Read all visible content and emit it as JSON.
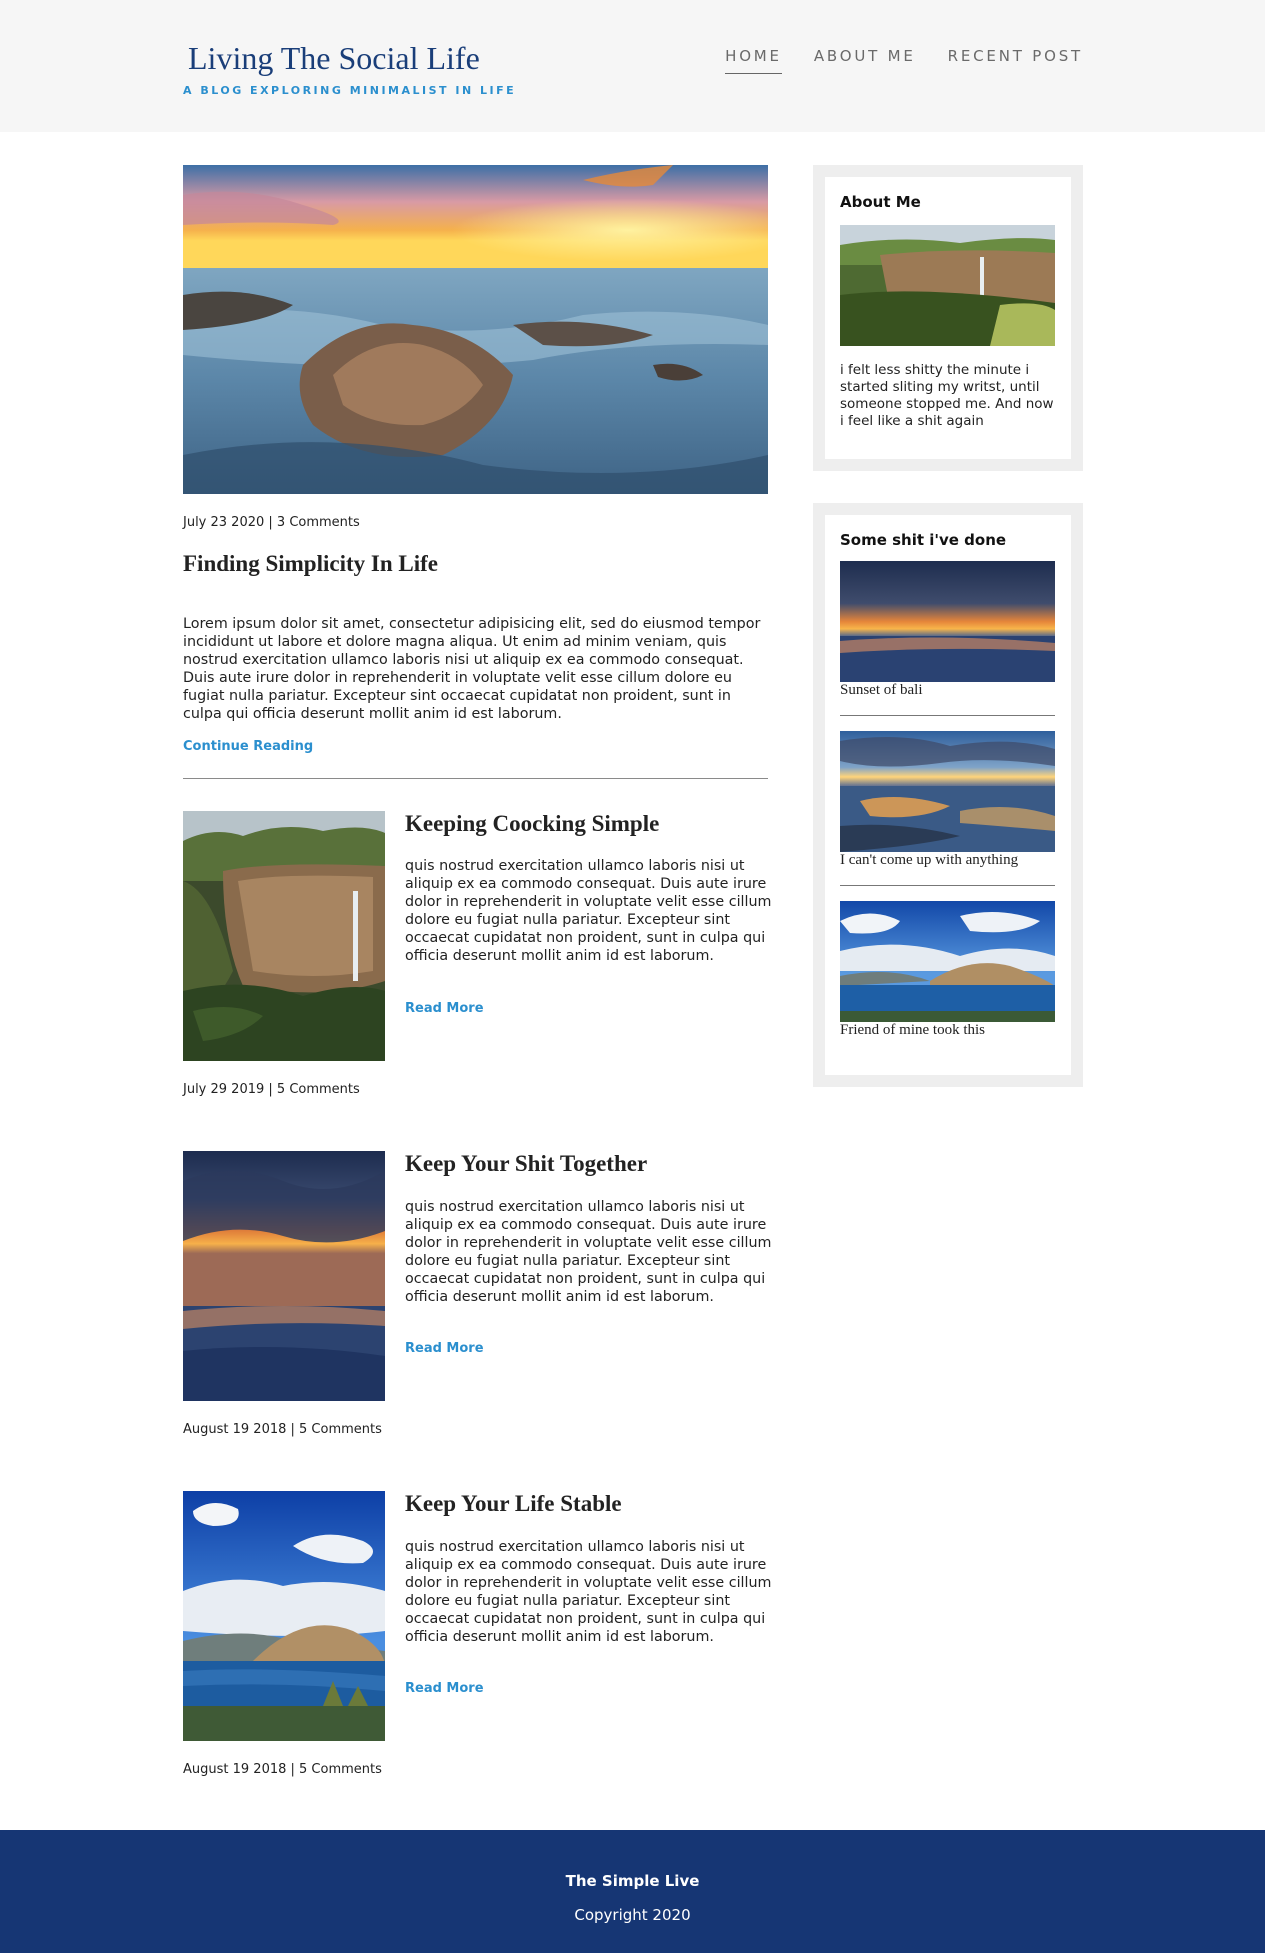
{
  "header": {
    "title": "Living The Social Life",
    "tagline": "A BLOG EXPLORING MINIMALIST IN LIFE",
    "nav": [
      {
        "label": "HOME"
      },
      {
        "label": "ABOUT ME"
      },
      {
        "label": "RECENT POST"
      }
    ]
  },
  "feature": {
    "meta": "July 23 2020 | 3 Comments",
    "title": "Finding Simplicity In Life",
    "body": "Lorem ipsum dolor sit amet, consectetur adipisicing elit, sed do eiusmod tempor incididunt ut labore et dolore magna aliqua. Ut enim ad minim veniam, quis nostrud exercitation ullamco laboris nisi ut aliquip ex ea commodo consequat. Duis aute irure dolor in reprehenderit in voluptate velit esse cillum dolore eu fugiat nulla pariatur. Excepteur sint occaecat cupidatat non proident, sunt in culpa qui officia deserunt mollit anim id est laborum.",
    "link": "Continue Reading"
  },
  "posts": [
    {
      "title": "Keeping Coocking Simple",
      "body": "quis nostrud exercitation ullamco laboris nisi ut aliquip ex ea commodo consequat. Duis aute irure dolor in reprehenderit in voluptate velit esse cillum dolore eu fugiat nulla pariatur. Excepteur sint occaecat cupidatat non proident, sunt in culpa qui officia deserunt mollit anim id est laborum.",
      "link": "Read More",
      "meta": "July 29 2019 | 5 Comments"
    },
    {
      "title": "Keep Your Shit Together",
      "body": "quis nostrud exercitation ullamco laboris nisi ut aliquip ex ea commodo consequat. Duis aute irure dolor in reprehenderit in voluptate velit esse cillum dolore eu fugiat nulla pariatur. Excepteur sint occaecat cupidatat non proident, sunt in culpa qui officia deserunt mollit anim id est laborum.",
      "link": "Read More",
      "meta": "August 19 2018 | 5 Comments"
    },
    {
      "title": "Keep Your Life Stable",
      "body": "quis nostrud exercitation ullamco laboris nisi ut aliquip ex ea commodo consequat. Duis aute irure dolor in reprehenderit in voluptate velit esse cillum dolore eu fugiat nulla pariatur. Excepteur sint occaecat cupidatat non proident, sunt in culpa qui officia deserunt mollit anim id est laborum.",
      "link": "Read More",
      "meta": "August 19 2018 | 5 Comments"
    }
  ],
  "sidebar": {
    "about": {
      "heading": "About Me",
      "text": "i felt less shitty the minute i started sliting my writst, until someone stopped me. And now i feel like a shit again"
    },
    "gallery": {
      "heading": "Some shit i've done",
      "items": [
        {
          "caption": "Sunset of bali"
        },
        {
          "caption": "I can't come up with anything"
        },
        {
          "caption": "Friend of mine took this"
        }
      ]
    }
  },
  "footer": {
    "title": "The Simple Live",
    "copyright": "Copyright 2020"
  }
}
